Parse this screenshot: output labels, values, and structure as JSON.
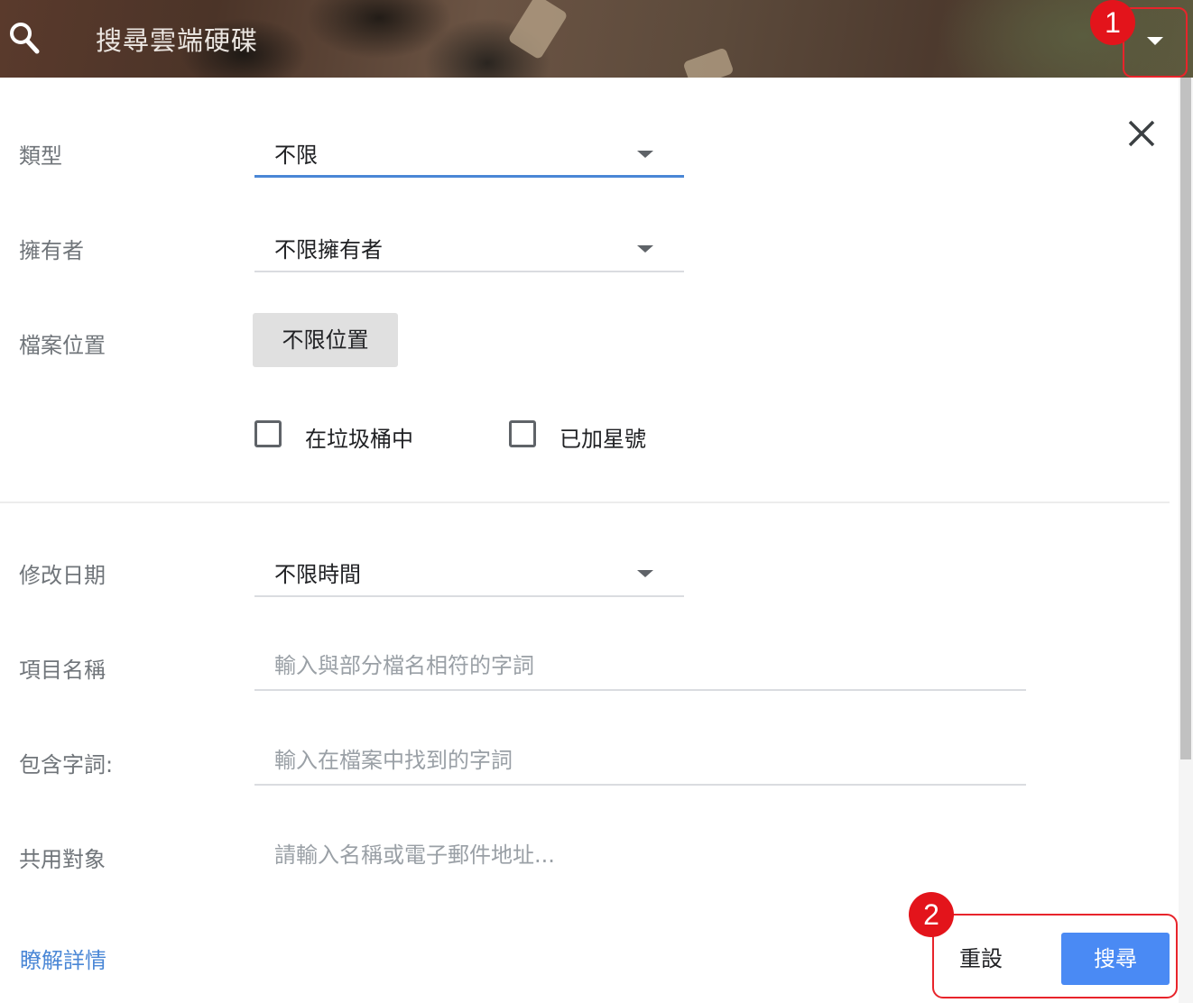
{
  "header": {
    "title": "搜尋雲端硬碟",
    "search_icon": "search-icon",
    "dropdown_icon": "caret-down-icon"
  },
  "annotations": {
    "badge1": "1",
    "badge2": "2",
    "highlight_color": "#e8242b"
  },
  "form": {
    "type": {
      "label": "類型",
      "value": "不限"
    },
    "owner": {
      "label": "擁有者",
      "value": "不限擁有者"
    },
    "location": {
      "label": "檔案位置",
      "button": "不限位置"
    },
    "checkboxes": [
      {
        "label": "在垃圾桶中",
        "checked": false
      },
      {
        "label": "已加星號",
        "checked": false
      }
    ],
    "modified": {
      "label": "修改日期",
      "value": "不限時間"
    },
    "item_name": {
      "label": "項目名稱",
      "placeholder": "輸入與部分檔名相符的字詞"
    },
    "has_words": {
      "label": "包含字詞:",
      "placeholder": "輸入在檔案中找到的字詞"
    },
    "shared_with": {
      "label": "共用對象",
      "placeholder": "請輸入名稱或電子郵件地址..."
    }
  },
  "footer": {
    "learn_more": "瞭解詳情",
    "reset": "重設",
    "search": "搜尋"
  },
  "colors": {
    "accent": "#4a87d6",
    "search_button": "#4a8af4"
  }
}
